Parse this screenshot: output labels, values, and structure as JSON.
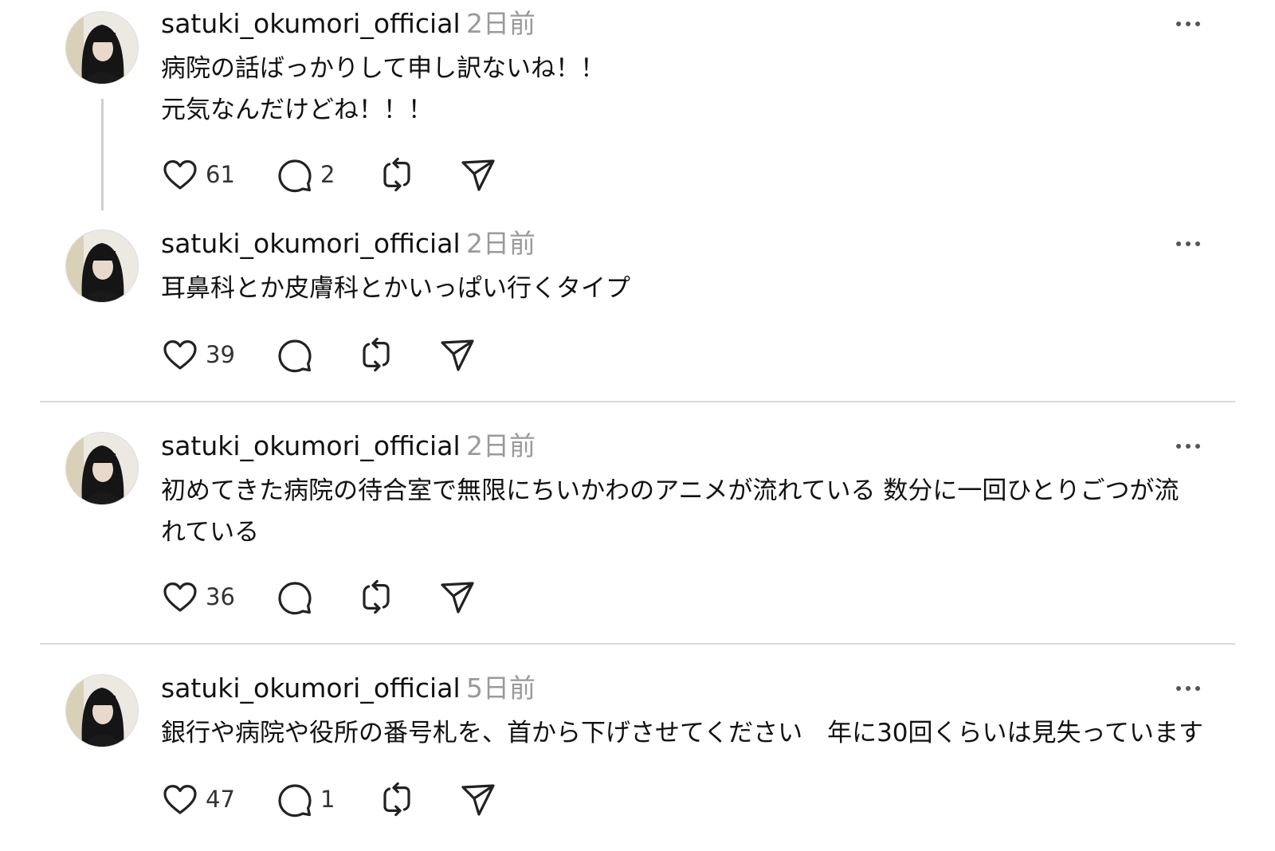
{
  "posts": [
    {
      "username": "satuki_okumori_official",
      "time": "2日前",
      "lines": [
        "病院の話ばっかりして申し訳ないね！！",
        "元気なんだけどね！！！"
      ],
      "likes": "61",
      "replies": "2"
    },
    {
      "username": "satuki_okumori_official",
      "time": "2日前",
      "lines": [
        "耳鼻科とか皮膚科とかいっぱい行くタイプ"
      ],
      "likes": "39",
      "replies": ""
    },
    {
      "username": "satuki_okumori_official",
      "time": "2日前",
      "lines": [
        "初めてきた病院の待合室で無限にちいかわのアニメが流れている 数分に一回ひとりごつが流",
        "れている"
      ],
      "likes": "36",
      "replies": ""
    },
    {
      "username": "satuki_okumori_official",
      "time": "5日前",
      "lines": [
        "銀行や病院や役所の番号札を、首から下げさせてください　年に30回くらいは見失っています"
      ],
      "likes": "47",
      "replies": "1"
    }
  ],
  "icons": {
    "like": "heart-icon",
    "reply": "speech-bubble-icon",
    "repost": "repost-icon",
    "share": "paper-plane-icon",
    "more": "ellipsis-icon"
  },
  "colors": {
    "text": "#111111",
    "secondary": "#9a9a9a",
    "divider": "#d9d9d9",
    "icon": "#222222"
  }
}
